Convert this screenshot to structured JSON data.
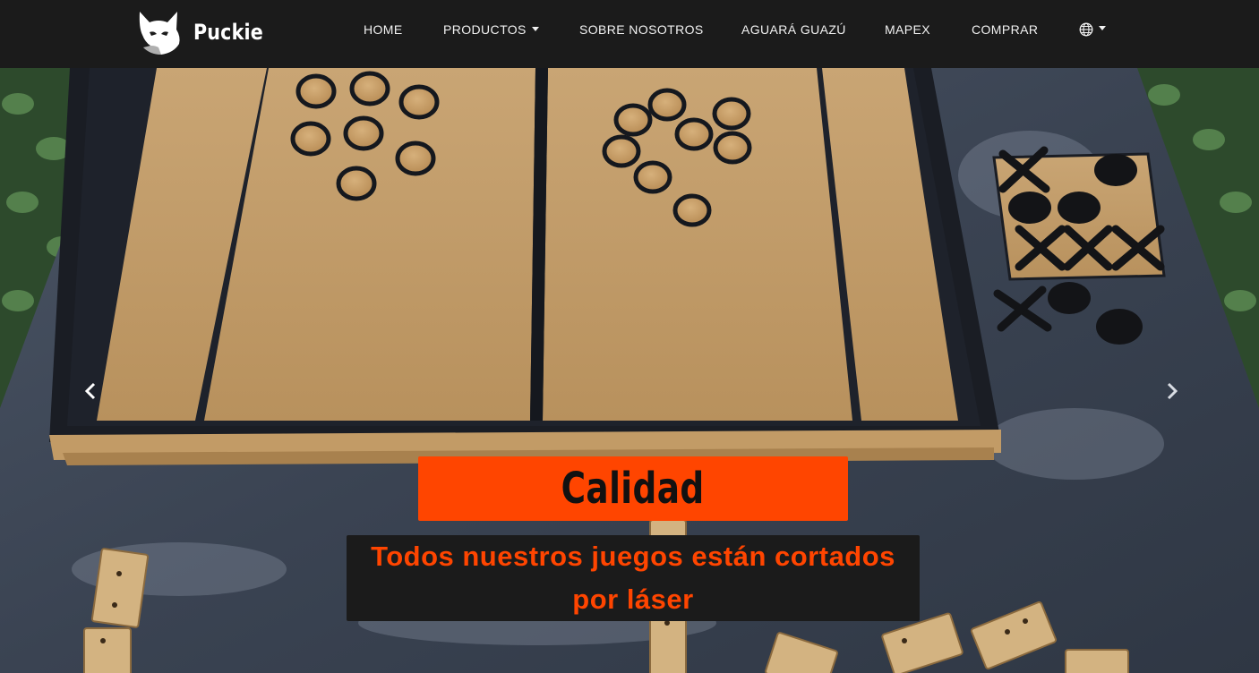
{
  "brand": {
    "name": "Puckie",
    "logo_icon": "fox-head-icon"
  },
  "nav": {
    "home": "HOME",
    "productos": "PRODUCTOS",
    "sobre": "SOBRE NOSOTROS",
    "aguara": "AGUARÁ GUAZÚ",
    "mapex": "MAPEX",
    "comprar": "COMPRAR",
    "language_icon": "globe-icon"
  },
  "carousel": {
    "title": "Calidad",
    "subtitle": "Todos nuestros juegos están cortados por láser",
    "prev_icon": "chevron-left-icon",
    "next_icon": "chevron-right-icon"
  },
  "colors": {
    "navbar_bg": "#1b1b1b",
    "accent": "#ff4500",
    "caption_bg": "#1b1b1b"
  }
}
